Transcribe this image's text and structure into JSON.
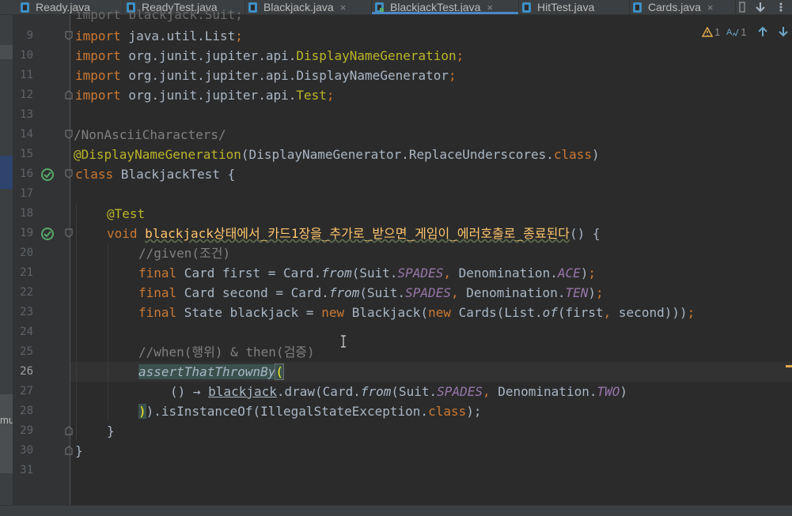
{
  "tabs": [
    {
      "label": "Ready.java",
      "active": false
    },
    {
      "label": "ReadyTest.java",
      "active": false
    },
    {
      "label": "Blackjack.java",
      "active": false
    },
    {
      "label": "BlackjackTest.java",
      "active": true
    },
    {
      "label": "HitTest.java",
      "active": false
    },
    {
      "label": "Cards.java",
      "active": false
    }
  ],
  "inspection": {
    "warnings": "1",
    "typos": "1"
  },
  "left_panel_fragment": "mu",
  "line_numbers": [
    "9",
    "10",
    "11",
    "12",
    "13",
    "14",
    "15",
    "16",
    "17",
    "18",
    "19",
    "20",
    "21",
    "22",
    "23",
    "24",
    "25",
    "26",
    "27",
    "28",
    "29",
    "30",
    "31"
  ],
  "code": {
    "line8": "import blackjack.Suit;",
    "line9_kw": "import",
    "line9_rest": " java.util.List",
    "line10_pkg": " org.junit.jupiter.api.",
    "line10_cls": "DisplayNameGeneration",
    "line11_rest": " org.junit.jupiter.api.DisplayNameGenerator",
    "line12_pkg": " org.junit.jupiter.api.",
    "line12_cls": "Test",
    "line14": "/NonAsciiCharacters/",
    "line15_ann": "@DisplayNameGeneration",
    "line15_args": "(DisplayNameGenerator.ReplaceUnderscores.",
    "line15_class": "class",
    "line16_kw": "class",
    "line16_rest": " BlackjackTest {",
    "line18": "@Test",
    "line19_kw": "void",
    "line19_name": "blackjack상태에서_카드1장을_추가로_받으면_게임이_에러호출로_종료된다",
    "line19_end": "() {",
    "line20": "//given(조건)",
    "line21_t": " Card first = Card.",
    "line21_from": "from",
    "line21_a": "(Suit.",
    "line21_f1": "SPADES",
    "line21_b": " Denomination.",
    "line21_f2": "ACE",
    "line22_t": " Card second = Card.",
    "line22_f2": "TEN",
    "line23_t": " State blackjack = ",
    "line23_new": "new",
    "line23_a": " Blackjack(",
    "line23_b": " Cards(List.",
    "line23_of": "of",
    "line23_c": "(first",
    "line23_d": " second)))",
    "line25": "//when(행위) & then(검증)",
    "line26": "assertThatThrownBy",
    "line27_a": "() → ",
    "line27_b": "blackjack",
    "line27_c": ".draw(Card.",
    "line27_f2": "TWO",
    "line28_a": ").isInstanceOf(IllegalStateException.",
    "line28_class": "class",
    "line29": "}",
    "line30": "}",
    "kw_import": "import",
    "kw_final": "final",
    "kw_new": "new",
    "kw_class": "class",
    "punct_semi": ";",
    "punct_comma": ",",
    "paren_open": "(",
    "paren_close": ")",
    "closing_semi": ");",
    "closing_paren": ")"
  },
  "colors": {
    "keyword": "#cc7832",
    "annotation": "#bbb529",
    "comment": "#808080",
    "field": "#9876aa",
    "method": "#ffc66d",
    "text": "#a9b7c6",
    "accent": "#4a88c7"
  }
}
